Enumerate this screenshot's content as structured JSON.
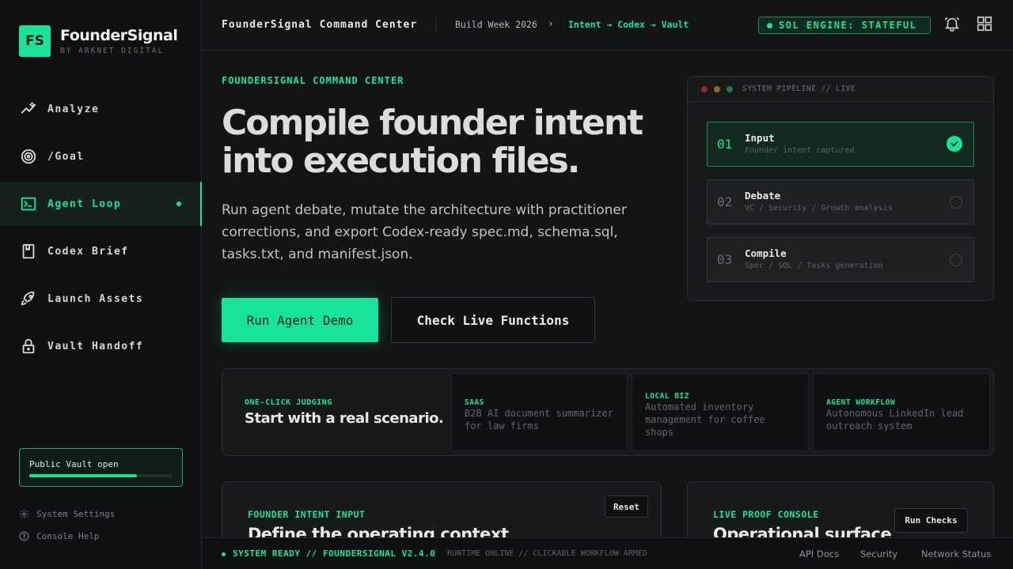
{
  "brand": {
    "logo": "FS",
    "name": "FounderSignal",
    "sub": "BY ARKNET DIGITAL"
  },
  "sidebar": {
    "items": [
      {
        "label": "Analyze",
        "icon": "analyze-icon"
      },
      {
        "label": "/Goal",
        "icon": "target-icon"
      },
      {
        "label": "Agent Loop",
        "icon": "terminal-icon",
        "active": true
      },
      {
        "label": "Codex Brief",
        "icon": "book-icon"
      },
      {
        "label": "Launch Assets",
        "icon": "rocket-icon"
      },
      {
        "label": "Vault Handoff",
        "icon": "lock-icon"
      }
    ],
    "vault": {
      "label": "Public Vault open",
      "progress": 0.75
    },
    "settings": "System Settings",
    "help": "Console Help"
  },
  "topbar": {
    "title": "FounderSignal Command Center",
    "build": "Build Week 2026",
    "chevron": "›",
    "flow": "Intent → Codex → Vault",
    "engine": "SOL ENGINE: STATEFUL"
  },
  "hero": {
    "eyebrow": "FOUNDERSIGNAL COMMAND CENTER",
    "title": "Compile founder intent into execution files.",
    "description": "Run agent debate, mutate the architecture with practitioner corrections, and export Codex-ready spec.md, schema.sql, tasks.txt, and manifest.json.",
    "primary_button": "Run Agent Demo",
    "secondary_button": "Check Live Functions"
  },
  "pipeline": {
    "title": "SYSTEM PIPELINE // LIVE",
    "steps": [
      {
        "num": "01",
        "name": "Input",
        "sub": "Founder intent captured",
        "done": true
      },
      {
        "num": "02",
        "name": "Debate",
        "sub": "VC / Security / Growth analysis",
        "done": false
      },
      {
        "num": "03",
        "name": "Compile",
        "sub": "Spec / SQL / Tasks generation",
        "done": false
      }
    ]
  },
  "scenarios": {
    "eyebrow": "ONE-CLICK JUDGING",
    "title": "Start with a real scenario.",
    "cards": [
      {
        "tag": "SAAS",
        "desc": "B2B AI document summarizer for law firms"
      },
      {
        "tag": "LOCAL BIZ",
        "desc": "Automated inventory management for coffee shops"
      },
      {
        "tag": "AGENT WORKFLOW",
        "desc": "Autonomous LinkedIn lead outreach system"
      }
    ]
  },
  "intent_panel": {
    "eyebrow": "FOUNDER INTENT INPUT",
    "title": "Define the operating context",
    "button": "Reset"
  },
  "proof_panel": {
    "eyebrow": "LIVE PROOF CONSOLE",
    "title": "Operational surface",
    "button": "Run Checks"
  },
  "status": {
    "main": "SYSTEM READY // FOUNDERSIGNAL V2.4.0",
    "sub": "RUNTIME ONLINE // CLICKABLE WORKFLOW ARMED",
    "links": [
      "API Docs",
      "Security",
      "Network Status"
    ]
  },
  "colors": {
    "accent": "#19e39a",
    "background": "#131416",
    "sidebar": "#0f1012"
  }
}
